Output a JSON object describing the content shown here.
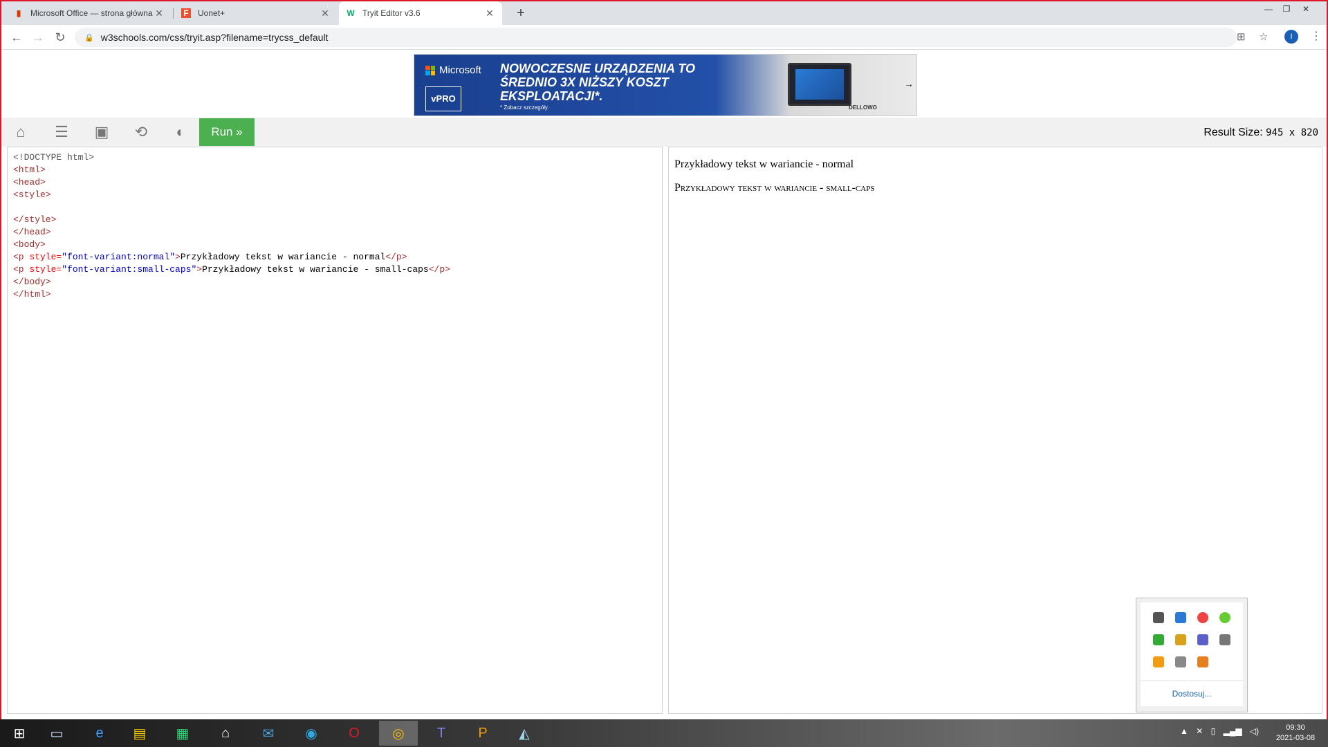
{
  "browser": {
    "tabs": [
      {
        "title": "Microsoft Office — strona główna",
        "favicon": "office-icon",
        "active": false
      },
      {
        "title": "Uonet+",
        "favicon": "uonet-icon",
        "active": false
      },
      {
        "title": "Tryit Editor v3.6",
        "favicon": "w3schools-icon",
        "active": true
      }
    ],
    "new_tab_label": "+",
    "url": "w3schools.com/css/tryit.asp?filename=trycss_default",
    "profile_initial": "I"
  },
  "ad": {
    "brand": "Microsoft",
    "badge": "vPRO",
    "headline": "NOWOCZESNE URZĄDZENIA TO ŚREDNIO 3X NIŻSZY KOSZT EKSPLOATACJI*.",
    "footnote": "* Zobacz szczegóły.",
    "sponsor": "DELLOWO"
  },
  "tryit": {
    "run_label": "Run »",
    "result_size_label": "Result Size:",
    "result_size_value": "945 x 820"
  },
  "code_lines": [
    "<!DOCTYPE html>",
    "<html>",
    "<head>",
    "<style>",
    "",
    "</style>",
    "</head>",
    "<body>",
    "<p style=\"font-variant:normal\">Przykładowy tekst w wariancie - normal</p>",
    "<p style=\"font-variant:small-caps\">Przykładowy tekst w wariancie - small-caps</p>",
    "</body>",
    "</html>"
  ],
  "result": {
    "p1": "Przykładowy tekst w wariancie - normal",
    "p2": "Przykładowy tekst w wariancie - small-caps"
  },
  "tray_popup": {
    "customize_label": "Dostosuj..."
  },
  "taskbar": {
    "time": "09:30",
    "date": "2021-03-08"
  },
  "colors": {
    "run_button": "#4caf50",
    "window_border": "#e0162b",
    "code_tag": "#a52a2a",
    "code_attr": "#ff0000",
    "code_value": "#0000cd"
  }
}
